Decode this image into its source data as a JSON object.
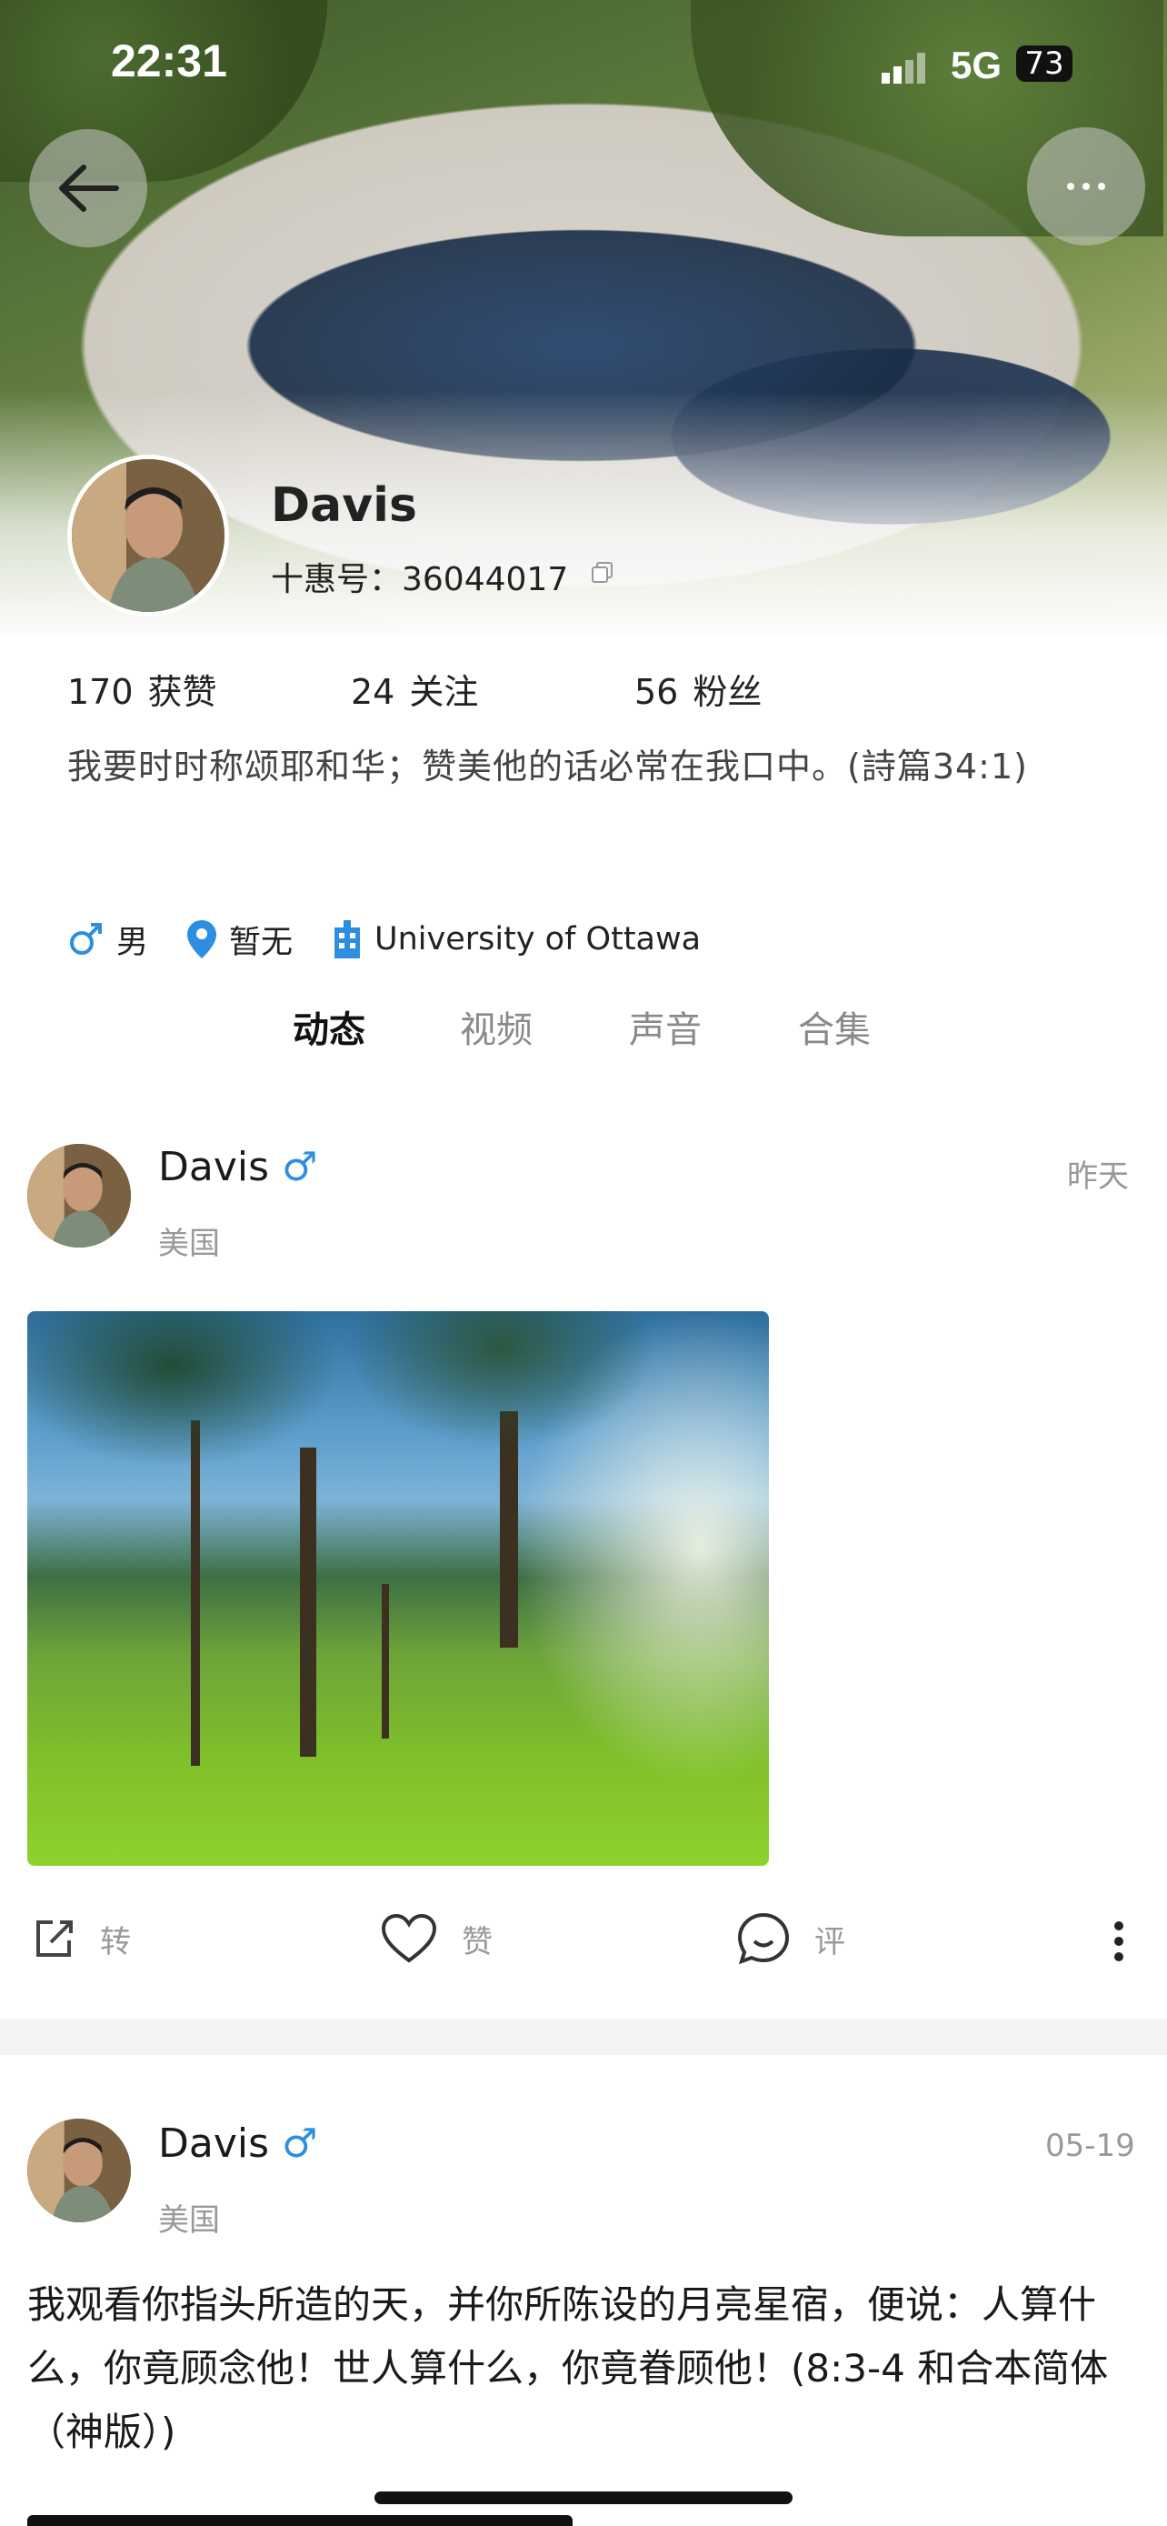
{
  "status_bar": {
    "time": "22:31",
    "network": "5G",
    "battery": "73"
  },
  "header": {
    "back_icon": "arrow-left-icon",
    "more_icon": "more-dots-icon",
    "more_label": "···"
  },
  "profile": {
    "name": "Davis",
    "id_label": "十惠号：36044017",
    "stats": {
      "likes": {
        "count": "170",
        "label": "获赞"
      },
      "following": {
        "count": "24",
        "label": "关注"
      },
      "followers": {
        "count": "56",
        "label": "粉丝"
      }
    },
    "bio": "我要时时称颂耶和华；赞美他的话必常在我口中。(詩篇34:1)",
    "tags": {
      "gender": "男",
      "location": "暂无",
      "school": "University of Ottawa"
    },
    "colors": {
      "accent": "#2d8ee0"
    }
  },
  "tabs": [
    {
      "label": "动态",
      "active": true
    },
    {
      "label": "视频",
      "active": false
    },
    {
      "label": "声音",
      "active": false
    },
    {
      "label": "合集",
      "active": false
    }
  ],
  "posts": [
    {
      "author": "Davis",
      "gender_symbol": "♂",
      "region": "美国",
      "date": "昨天",
      "actions": {
        "share": "转",
        "like": "赞",
        "comment": "评"
      }
    },
    {
      "author": "Davis",
      "gender_symbol": "♂",
      "region": "美国",
      "date": "05-19",
      "text": "我观看你指头所造的天，并你所陈设的月亮星宿，便说：人算什么，你竟顾念他！世人算什么，你竟眷顾他！(8:3-4 和合本简体（神版）)"
    }
  ]
}
